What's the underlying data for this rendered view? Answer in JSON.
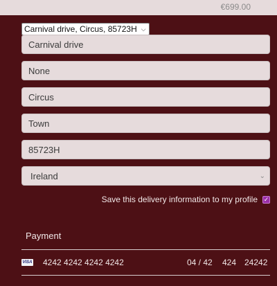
{
  "header": {
    "price": "€699.00"
  },
  "address_select": {
    "value": "Carnival drive, Circus, 85723H"
  },
  "fields": {
    "street": "Carnival drive",
    "line2": "None",
    "city": "Circus",
    "county": "Town",
    "postcode": "85723H",
    "country": "Ireland"
  },
  "save_info": {
    "label": "Save this delivery information to my profile",
    "checked": true
  },
  "payment": {
    "title": "Payment",
    "card_brand": "VISA",
    "card_number": "4242 4242 4242 4242",
    "expiry": "04 / 42",
    "cvc": "424",
    "zip": "24242"
  },
  "colors": {
    "background": "#4d1015",
    "field_bg": "#e6dbdc",
    "checkbox_accent": "#9b2fa8"
  }
}
